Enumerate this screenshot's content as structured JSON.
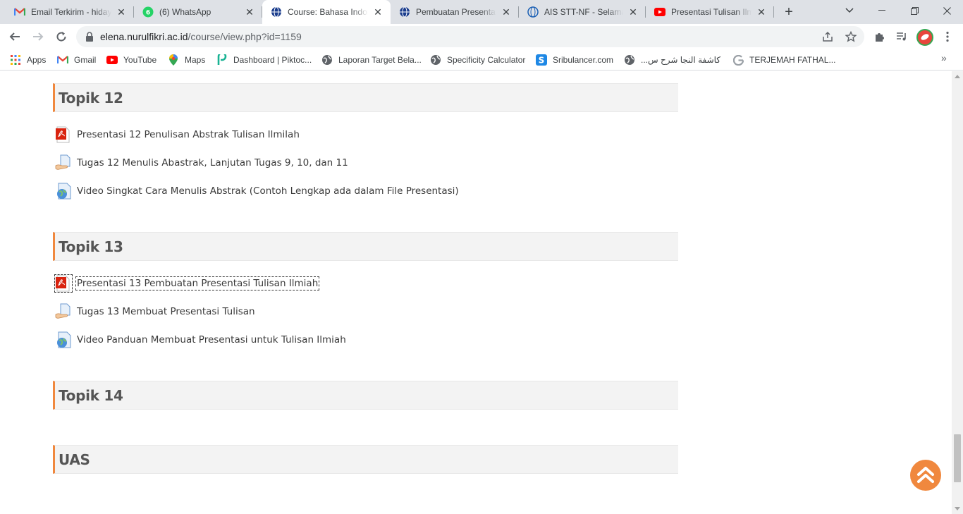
{
  "browser": {
    "tabs": [
      {
        "title": "Email Terkirim - hidayat",
        "icon": "gmail-icon"
      },
      {
        "title": "(6) WhatsApp",
        "icon": "whatsapp-icon"
      },
      {
        "title": "Course: Bahasa Indonesia",
        "icon": "moodle-globe-icon",
        "active": true
      },
      {
        "title": "Pembuatan Presentasi",
        "icon": "moodle-globe-icon"
      },
      {
        "title": "AIS STT-NF - Selamat",
        "icon": "ais-globe-icon"
      },
      {
        "title": "Presentasi Tulisan Ilmiah",
        "icon": "youtube-icon"
      }
    ],
    "address": {
      "domain": "elena.nurulfikri.ac.id",
      "path": "/course/view.php?id=1159"
    },
    "bookmarks": [
      {
        "label": "Apps",
        "icon": "apps-grid-icon"
      },
      {
        "label": "Gmail",
        "icon": "gmail-icon"
      },
      {
        "label": "YouTube",
        "icon": "youtube-icon"
      },
      {
        "label": "Maps",
        "icon": "maps-pin-icon"
      },
      {
        "label": "Dashboard | Piktoc...",
        "icon": "piktochart-icon"
      },
      {
        "label": "Laporan Target Bela...",
        "icon": "globe-icon"
      },
      {
        "label": "Specificity Calculator",
        "icon": "globe-icon"
      },
      {
        "label": "Sribulancer.com",
        "icon": "sribulancer-icon"
      },
      {
        "label": "كاشفة النجا شرح س...",
        "icon": "globe-icon"
      },
      {
        "label": "TERJEMAH FATHAL...",
        "icon": "google-icon"
      }
    ]
  },
  "course": {
    "sections": [
      {
        "title": "Topik 12",
        "activities": [
          {
            "label": "Presentasi 12 Penulisan Abstrak Tulisan Ilmilah",
            "type": "pdf-icon"
          },
          {
            "label": "Tugas 12 Menulis Abastrak, Lanjutan Tugas 9, 10, dan 11",
            "type": "assignment-icon"
          },
          {
            "label": "Video Singkat Cara Menulis Abstrak (Contoh Lengkap ada dalam File Presentasi)",
            "type": "url-icon"
          }
        ]
      },
      {
        "title": "Topik 13",
        "activities": [
          {
            "label": "Presentasi 13 Pembuatan Presentasi Tulisan Ilmiah",
            "type": "pdf-icon",
            "focused": true
          },
          {
            "label": "Tugas 13 Membuat Presentasi Tulisan",
            "type": "assignment-icon"
          },
          {
            "label": "Video Panduan Membuat Presentasi untuk Tulisan Ilmiah",
            "type": "url-icon"
          }
        ]
      },
      {
        "title": "Topik 14",
        "activities": []
      },
      {
        "title": "UAS",
        "activities": []
      }
    ]
  },
  "colors": {
    "accent": "#f0883e",
    "section_bg": "#f3f3f3"
  }
}
